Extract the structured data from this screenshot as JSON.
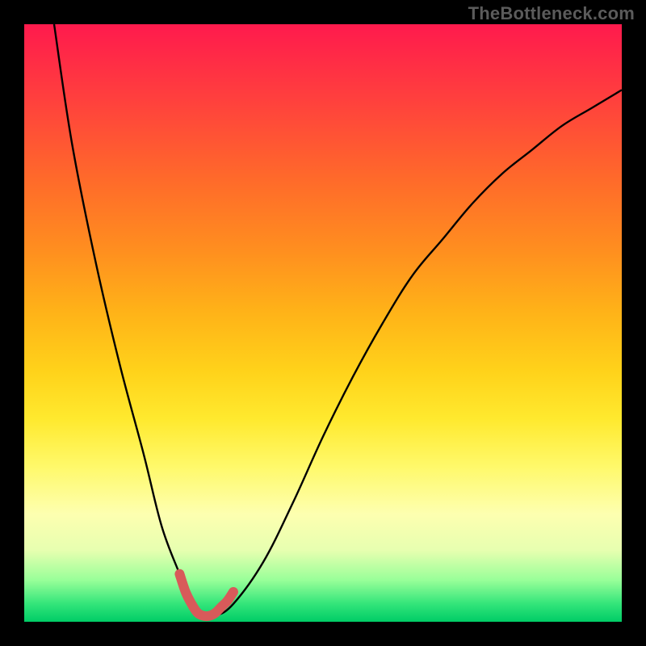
{
  "watermark": "TheBottleneck.com",
  "colors": {
    "frame": "#000000",
    "curve": "#000000",
    "highlight": "#d85a5a",
    "gradient_top": "#ff1a4d",
    "gradient_bottom": "#00cc66"
  },
  "chart_data": {
    "type": "line",
    "title": "",
    "xlabel": "",
    "ylabel": "",
    "xlim": [
      0,
      100
    ],
    "ylim": [
      0,
      100
    ],
    "grid": false,
    "legend": false,
    "series": [
      {
        "name": "bottleneck-curve",
        "x": [
          5,
          8,
          12,
          16,
          20,
          23,
          26,
          28,
          30,
          32,
          35,
          40,
          45,
          50,
          55,
          60,
          65,
          70,
          75,
          80,
          85,
          90,
          95,
          100
        ],
        "values": [
          100,
          80,
          60,
          43,
          28,
          16,
          8,
          3,
          1,
          1,
          3,
          10,
          20,
          31,
          41,
          50,
          58,
          64,
          70,
          75,
          79,
          83,
          86,
          89
        ]
      },
      {
        "name": "highlight-near-minimum",
        "x": [
          26,
          27,
          28,
          29,
          30,
          31,
          32,
          33,
          34,
          35
        ],
        "values": [
          8,
          5,
          3,
          1.5,
          1,
          1,
          1.5,
          2.5,
          3.5,
          5
        ]
      }
    ],
    "annotations": []
  }
}
